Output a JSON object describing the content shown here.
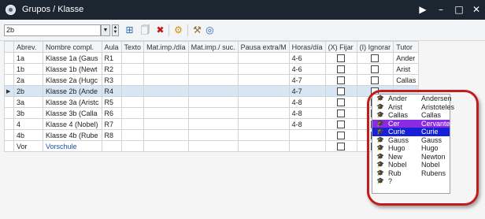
{
  "window": {
    "title": "Grupos / Klasse"
  },
  "colors": {
    "titlebar": "#1c2630",
    "selected_row": "#d8e6f4",
    "highlight_ring": "#c21d1d",
    "option_purple": "#8a2be2",
    "option_blue": "#1520d8",
    "link": "#1a4fb5"
  },
  "icons": [
    "app-icon",
    "play-icon",
    "minimize-icon",
    "maximize-icon",
    "close-icon",
    "new-row-icon",
    "new-doc-icon",
    "delete-icon",
    "settings-icon",
    "tools-icon",
    "globe-icon",
    "tutor-icon"
  ],
  "toolbar": {
    "selector_value": "2b",
    "dd_arrow": "▼"
  },
  "grid": {
    "columns": [
      "Abrev.",
      "Nombre compl.",
      "Aula",
      "Texto",
      "Mat.imp./día",
      "Mat.imp./ suc.",
      "Pausa extra/M",
      "Horas/día",
      "(X) Fijar",
      "(I) Ignorar",
      "Tutor"
    ],
    "rows": [
      {
        "abbrev": "1a",
        "name": "Klasse 1a (Gaus",
        "room": "R1",
        "hours": "4-6",
        "tutor": "Ander"
      },
      {
        "abbrev": "1b",
        "name": "Klasse 1b (Newt",
        "room": "R2",
        "hours": "4-6",
        "tutor": "Arist"
      },
      {
        "abbrev": "2a",
        "name": "Klasse 2a (Hugc",
        "room": "R3",
        "hours": "4-7",
        "tutor": "Callas"
      },
      {
        "abbrev": "2b",
        "name": "Klasse 2b (Ande",
        "room": "R4",
        "hours": "4-7",
        "tutor": ""
      },
      {
        "abbrev": "3a",
        "name": "Klasse 3a (Aristc",
        "room": "R5",
        "hours": "4-8",
        "tutor": ""
      },
      {
        "abbrev": "3b",
        "name": "Klasse 3b (Calla",
        "room": "R6",
        "hours": "4-8",
        "tutor": ""
      },
      {
        "abbrev": "4",
        "name": "Klasse 4 (Nobel)",
        "room": "R7",
        "hours": "4-8",
        "tutor": ""
      },
      {
        "abbrev": "4b",
        "name": "Klasse 4b (Rube",
        "room": "R8",
        "hours": "",
        "tutor": ""
      },
      {
        "abbrev": "Vor",
        "name": "Vorschule",
        "room": "",
        "hours": "",
        "tutor": ""
      }
    ]
  },
  "tutor_dropdown": {
    "options": [
      {
        "key": "Ander",
        "name": "Andersen"
      },
      {
        "key": "Arist",
        "name": "Aristoteles"
      },
      {
        "key": "Callas",
        "name": "Callas"
      },
      {
        "key": "Cer",
        "name": "Cervantes"
      },
      {
        "key": "Curie",
        "name": "Curie"
      },
      {
        "key": "Gauss",
        "name": "Gauss"
      },
      {
        "key": "Hugo",
        "name": "Hugo"
      },
      {
        "key": "New",
        "name": "Newton"
      },
      {
        "key": "Nobel",
        "name": "Nobel"
      },
      {
        "key": "Rub",
        "name": "Rubens"
      },
      {
        "key": "?",
        "name": ""
      }
    ]
  }
}
